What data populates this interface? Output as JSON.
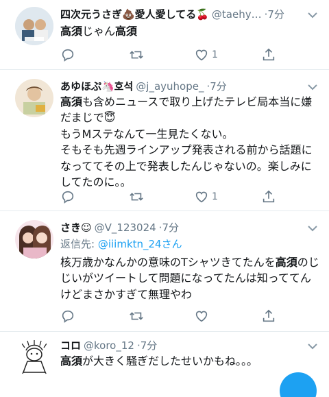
{
  "tweets": [
    {
      "name": "四次元うさぎ💩愛人愛してる🍒",
      "handle": "@taehy…",
      "time": "7分",
      "reply_prefix": "",
      "reply_mention": "",
      "text_parts": [
        "高須",
        "じゃん",
        "高須",
        ""
      ],
      "likes": "1",
      "avatar_desc": "avatar"
    },
    {
      "name": "あゆほぷ🦄호석",
      "handle": "@j_ayuhope_",
      "time": "7分",
      "reply_prefix": "",
      "reply_mention": "",
      "text_parts": [
        "高須",
        "も含めニュースで取り上げたテレビ局本当に嫌だまじで😇\nもうMステなんて一生見たくない。\nそもそも先週ラインアップ発表される前から話題になっててその上で発表したんじゃないの。楽しみにしてたのに。。",
        "",
        ""
      ],
      "likes": "1",
      "avatar_desc": "avatar"
    },
    {
      "name": "さき☺",
      "handle": "@V_123024",
      "time": "7分",
      "reply_prefix": "返信先: ",
      "reply_mention": "@iiimktn_24さん",
      "text_parts": [
        "核万歳かなんかの意味のTシャツきてたんを",
        "高須",
        "のじじいがツイートして問題になってたんは知っててんけどまさかすぎて無理やわ",
        ""
      ],
      "likes": "",
      "avatar_desc": "avatar"
    },
    {
      "name": "コロ",
      "handle": "@koro_12",
      "time": "7分",
      "reply_prefix": "",
      "reply_mention": "",
      "text_parts": [
        "高須",
        "が大きく騒ぎだしたせいかもね。。。",
        "",
        ""
      ],
      "likes": "",
      "avatar_desc": "avatar"
    }
  ],
  "icons": {
    "reply": "reply-icon",
    "retweet": "retweet-icon",
    "like": "heart-icon",
    "share": "share-icon",
    "menu": "chevron-down-icon"
  },
  "colors": {
    "text": "#14171a",
    "secondary": "#657786",
    "link": "#1da1f2",
    "divider": "#e6ecf0"
  }
}
